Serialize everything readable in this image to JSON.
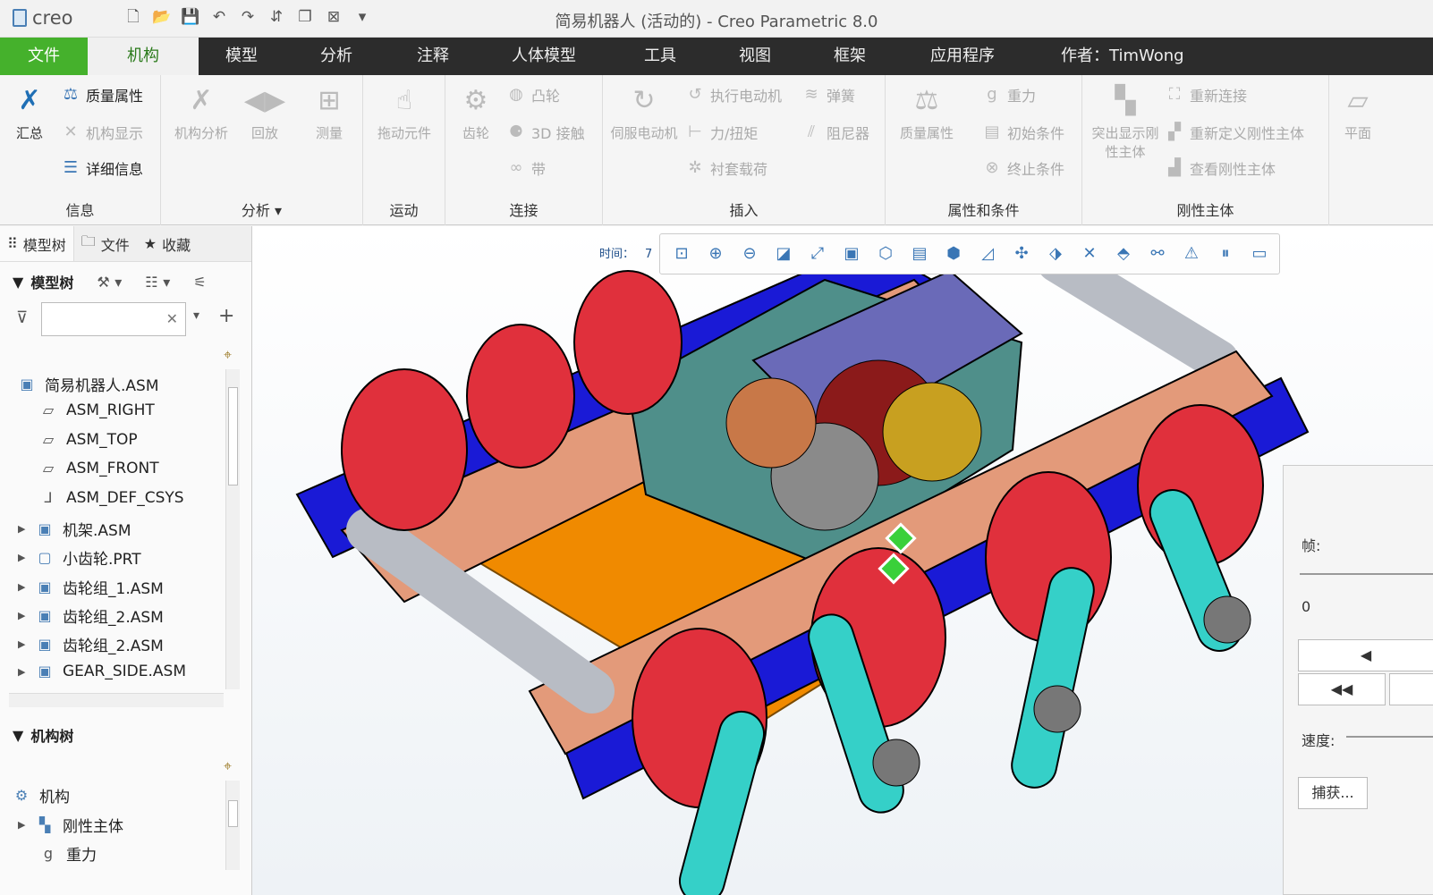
{
  "app": {
    "logo": "creo",
    "window_title": "简易机器人 (活动的) - Creo Parametric 8.0"
  },
  "tabs": {
    "file": "文件",
    "active": "机构",
    "items": [
      "模型",
      "分析",
      "注释",
      "人体模型",
      "工具",
      "视图",
      "框架",
      "应用程序",
      "作者：TimWong"
    ]
  },
  "ribbon": {
    "info": {
      "label": "信息",
      "summary": "汇总",
      "mass_props": "质量属性",
      "mech_display": "机构显示",
      "details": "详细信息"
    },
    "analysis": {
      "label": "分析",
      "mech_analysis": "机构分析",
      "playback": "回放",
      "measure": "测量"
    },
    "motion": {
      "label": "运动",
      "drag": "拖动元件"
    },
    "connect": {
      "label": "连接",
      "gear": "齿轮",
      "cam": "凸轮",
      "contact3d": "3D 接触",
      "belt": "带"
    },
    "insert": {
      "label": "插入",
      "servo": "伺服电动机",
      "actuator": "执行电动机",
      "force": "力/扭矩",
      "bushing": "衬套载荷",
      "spring": "弹簧",
      "damper": "阻尼器"
    },
    "props": {
      "label": "属性和条件",
      "mass_props": "质量属性",
      "gravity": "重力",
      "init": "初始条件",
      "term": "终止条件"
    },
    "rigid": {
      "label": "刚性主体",
      "highlight": "突出显示刚性主体",
      "reconnect": "重新连接",
      "redefine": "重新定义刚性主体",
      "view": "查看刚性主体"
    },
    "plane": "平面"
  },
  "left_panel": {
    "tabs": [
      "模型树",
      "文件",
      "收藏"
    ],
    "model_tree_title": "模型树",
    "filter_placeholder": "",
    "tree": [
      {
        "label": "简易机器人.ASM",
        "icon": "assembly-icon",
        "expand": ""
      },
      {
        "label": "ASM_RIGHT",
        "icon": "plane-icon",
        "expand": ""
      },
      {
        "label": "ASM_TOP",
        "icon": "plane-icon",
        "expand": ""
      },
      {
        "label": "ASM_FRONT",
        "icon": "plane-icon",
        "expand": ""
      },
      {
        "label": "ASM_DEF_CSYS",
        "icon": "csys-icon",
        "expand": ""
      },
      {
        "label": "机架.ASM",
        "icon": "assembly-icon",
        "expand": "▶"
      },
      {
        "label": "小齿轮.PRT",
        "icon": "part-icon",
        "expand": "▶"
      },
      {
        "label": "齿轮组_1.ASM",
        "icon": "assembly-icon",
        "expand": "▶"
      },
      {
        "label": "齿轮组_2.ASM",
        "icon": "assembly-icon",
        "expand": "▶"
      },
      {
        "label": "齿轮组_2.ASM",
        "icon": "assembly-icon",
        "expand": "▶"
      },
      {
        "label": "GEAR_SIDE.ASM",
        "icon": "assembly-icon",
        "expand": "▶"
      }
    ],
    "mech_tree_title": "机构树",
    "mech_tree": [
      {
        "label": "机构",
        "icon": "mechanism-icon",
        "expand": ""
      },
      {
        "label": "刚性主体",
        "icon": "rigid-body-icon",
        "expand": "▶"
      },
      {
        "label": "重力",
        "icon": "gravity-icon",
        "expand": ""
      }
    ]
  },
  "viewport": {
    "time_label": "时间：",
    "time_value": "7"
  },
  "play_panel": {
    "frame_label": "帧:",
    "frame_value": "0",
    "play_back": "◀",
    "rewind": "◀◀",
    "speed_label": "速度:",
    "capture": "捕获..."
  },
  "colors": {
    "file_tab": "#45b12c",
    "tab_bar": "#2c2c2c",
    "accent": "#2a7a1a",
    "wheel": "#e0303c",
    "frame": "#e39a7a",
    "track": "#1a1ad6",
    "plate": "#f08a00",
    "link": "#35d0c8"
  }
}
